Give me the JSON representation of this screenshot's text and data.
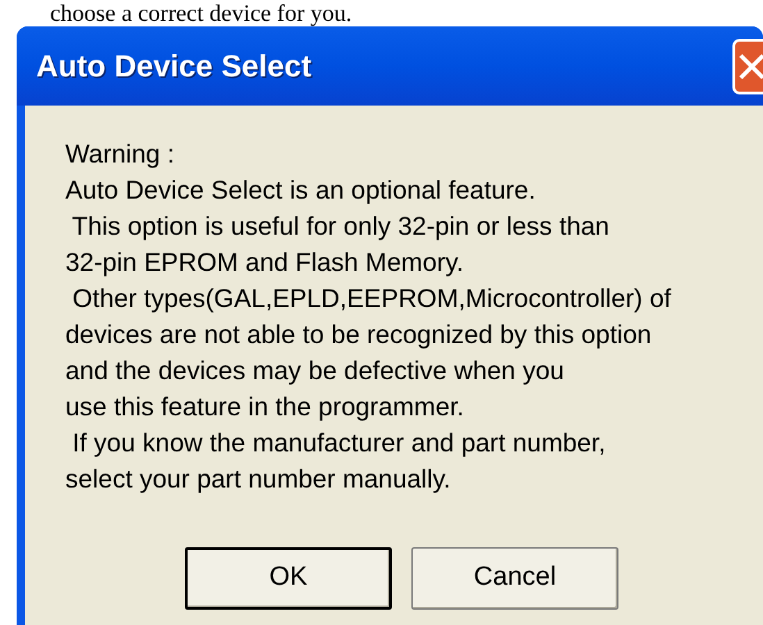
{
  "page_text": "choose a correct device for you.",
  "dialog": {
    "title": "Auto Device Select",
    "message_lines": [
      "Warning :",
      "Auto Device Select is an optional feature.",
      " This option is useful for only 32-pin or less than",
      "32-pin EPROM and Flash Memory.",
      " Other types(GAL,EPLD,EEPROM,Microcontroller) of",
      "devices are not able to be recognized by this option",
      "and the devices may be defective when you",
      "use this feature in the programmer.",
      " If you know the manufacturer and part number,",
      "select your part number manually."
    ],
    "buttons": [
      {
        "label": "OK",
        "default": true
      },
      {
        "label": "Cancel",
        "default": false
      }
    ]
  }
}
